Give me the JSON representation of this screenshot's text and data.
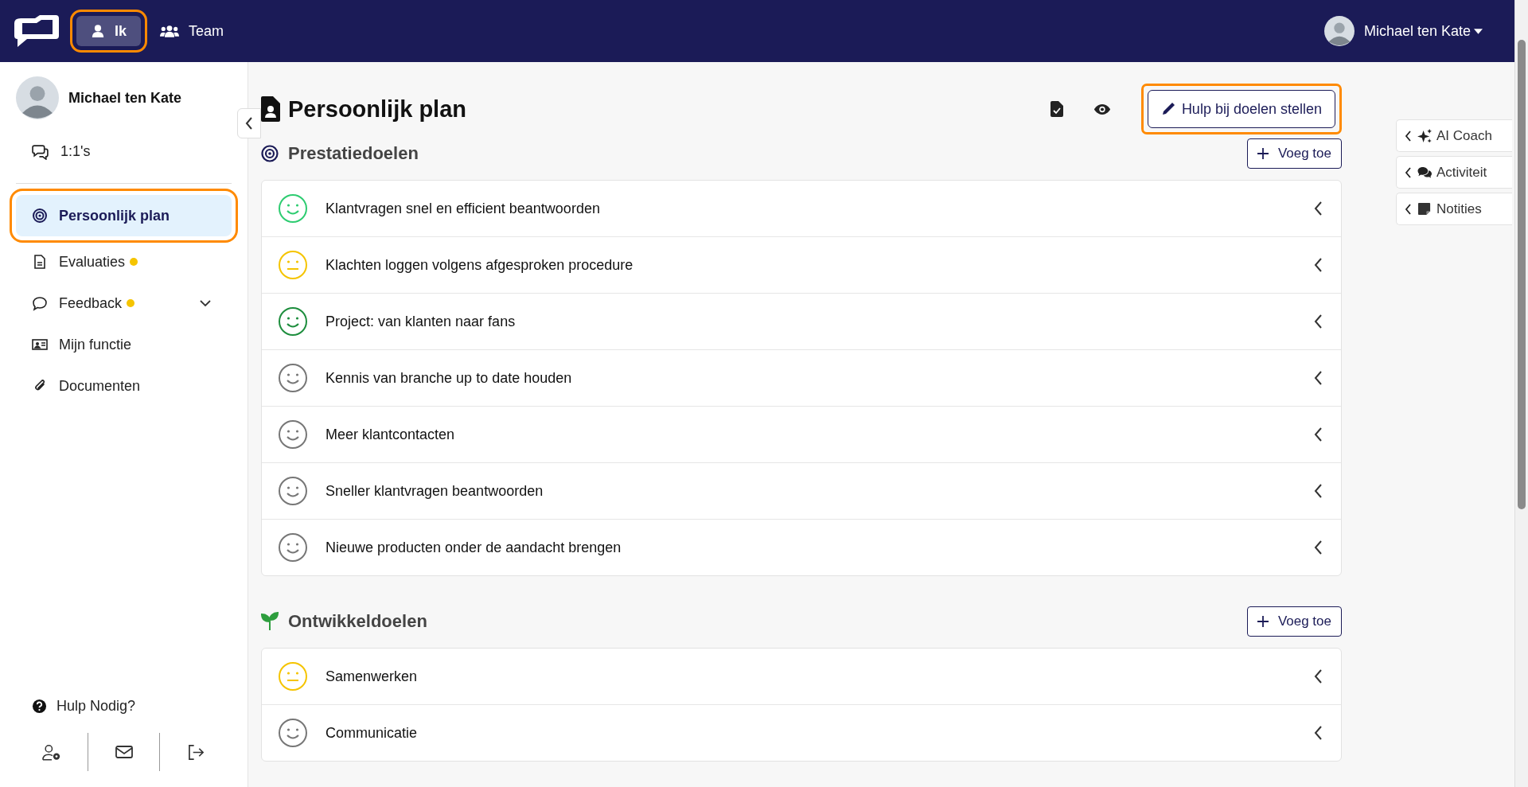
{
  "topbar": {
    "tabs": [
      {
        "label": "Ik",
        "selected": true,
        "highlighted": true
      },
      {
        "label": "Team",
        "selected": false,
        "highlighted": false
      }
    ],
    "user": "Michael ten Kate"
  },
  "sidebar": {
    "user": "Michael ten Kate",
    "top_items": [
      {
        "label": "1:1's",
        "selected": false
      }
    ],
    "items": [
      {
        "label": "Persoonlijk plan",
        "selected": true,
        "highlighted": true,
        "dot": false,
        "kind": "link"
      },
      {
        "label": "Evaluaties",
        "selected": false,
        "highlighted": false,
        "dot": true,
        "kind": "link"
      },
      {
        "label": "Feedback",
        "selected": false,
        "highlighted": false,
        "dot": true,
        "kind": "group",
        "expanded": false
      },
      {
        "label": "Mijn functie",
        "selected": false,
        "highlighted": false,
        "dot": false,
        "kind": "link"
      },
      {
        "label": "Documenten",
        "selected": false,
        "highlighted": false,
        "dot": false,
        "kind": "link"
      }
    ],
    "help": "Hulp Nodig?"
  },
  "main": {
    "title": "Persoonlijk plan",
    "help_button": {
      "label": "Hulp bij doelen stellen",
      "highlighted": true
    },
    "sections": [
      {
        "title": "Prestatiedoelen",
        "add_label": "Voeg toe",
        "goals": [
          {
            "title": "Klantvragen snel en efficient beantwoorden",
            "kind": "happy",
            "color": "#2ecc71"
          },
          {
            "title": "Klachten loggen volgens afgesproken procedure",
            "kind": "neutral",
            "color": "#f5c400"
          },
          {
            "title": "Project: van klanten naar fans",
            "kind": "happy",
            "color": "#1e8e3e"
          },
          {
            "title": "Kennis van branche up to date houden",
            "kind": "happy",
            "color": "#777777"
          },
          {
            "title": "Meer klantcontacten",
            "kind": "happy",
            "color": "#777777"
          },
          {
            "title": "Sneller klantvragen beantwoorden",
            "kind": "happy",
            "color": "#777777"
          },
          {
            "title": "Nieuwe producten onder de aandacht brengen",
            "kind": "happy",
            "color": "#777777"
          }
        ]
      },
      {
        "title": "Ontwikkeldoelen",
        "add_label": "Voeg toe",
        "goals": [
          {
            "title": "Samenwerken",
            "kind": "neutral",
            "color": "#f5c400"
          },
          {
            "title": "Communicatie",
            "kind": "happy",
            "color": "#777777"
          }
        ]
      }
    ]
  },
  "side_panel": {
    "tabs": [
      {
        "label": "AI Coach"
      },
      {
        "label": "Activiteit"
      },
      {
        "label": "Notities"
      }
    ]
  }
}
